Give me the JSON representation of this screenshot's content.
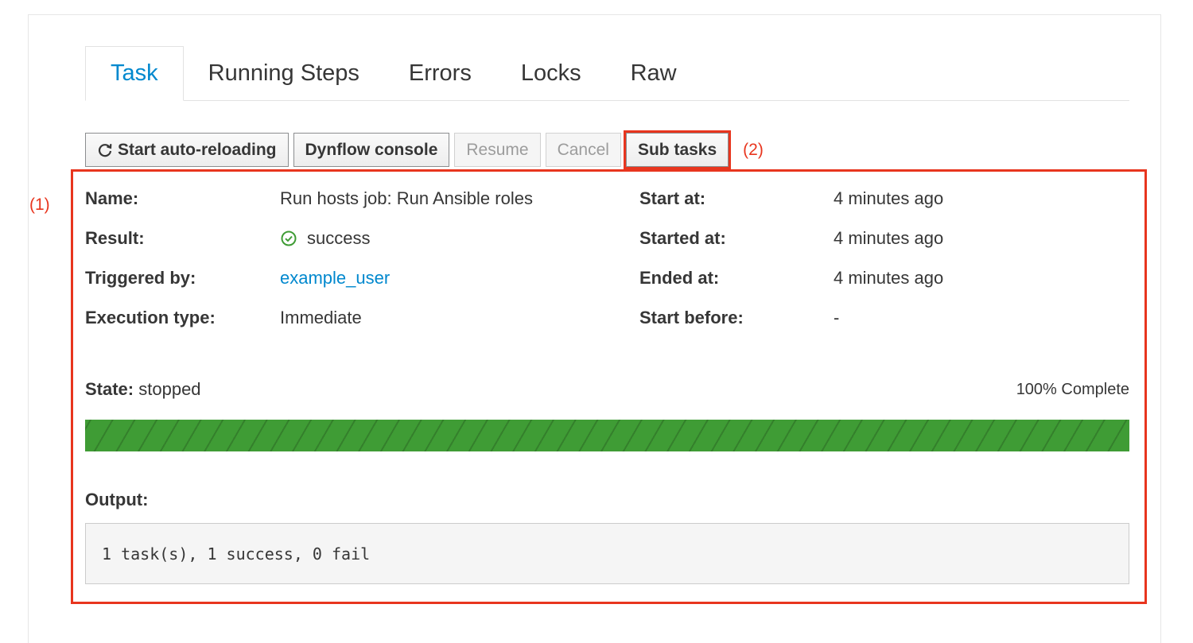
{
  "tabs": [
    {
      "label": "Task",
      "active": true
    },
    {
      "label": "Running Steps",
      "active": false
    },
    {
      "label": "Errors",
      "active": false
    },
    {
      "label": "Locks",
      "active": false
    },
    {
      "label": "Raw",
      "active": false
    }
  ],
  "toolbar": {
    "auto_reload_label": "Start auto-reloading",
    "dynflow_label": "Dynflow console",
    "resume_label": "Resume",
    "cancel_label": "Cancel",
    "subtasks_label": "Sub tasks"
  },
  "annotations": {
    "details_marker": "(1)",
    "subtasks_marker": "(2)",
    "color": "#e8351e"
  },
  "details": {
    "name_label": "Name:",
    "name_value": "Run hosts job: Run Ansible roles",
    "result_label": "Result:",
    "result_value": "success",
    "triggered_label": "Triggered by:",
    "triggered_value": "example_user",
    "exec_type_label": "Execution type:",
    "exec_type_value": "Immediate",
    "start_at_label": "Start at:",
    "start_at_value": "4 minutes ago",
    "started_at_label": "Started at:",
    "started_at_value": "4 minutes ago",
    "ended_at_label": "Ended at:",
    "ended_at_value": "4 minutes ago",
    "start_before_label": "Start before:",
    "start_before_value": "-"
  },
  "state": {
    "label": "State:",
    "value": "stopped",
    "complete_text": "100% Complete",
    "progress_fraction": 1.0,
    "progress_color": "#3f9c35"
  },
  "output": {
    "label": "Output:",
    "text": "1 task(s), 1 success, 0 fail"
  },
  "colors": {
    "accent": "#0088ce",
    "success": "#3f9c35"
  },
  "icons": {
    "reload": "refresh-icon",
    "result": "check-circle-icon"
  }
}
